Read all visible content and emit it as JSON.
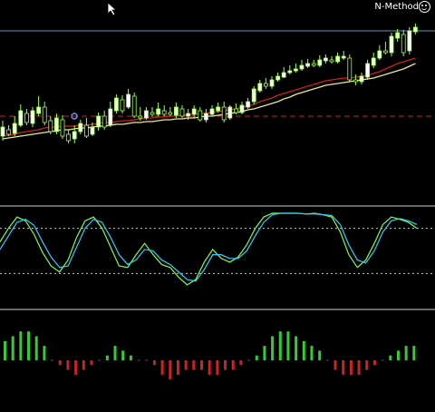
{
  "app": {
    "indicator_label": "N-Method"
  },
  "icons": {
    "ea_status": "smiley-face-icon",
    "pointer": "mouse-cursor-icon"
  },
  "colors": {
    "background": "#000000",
    "candle_bull": "#ffffff",
    "candle_border": "#9bff4c",
    "ma_fast": "#cc1f1f",
    "ma_slow": "#f0e68c",
    "level_line": "#cc2222",
    "price_line": "#5f8fbf",
    "stoch_main": "#7cff4c",
    "stoch_signal": "#33ccff",
    "hist_up": "#33cc33",
    "hist_down": "#cc2222",
    "separator": "#cfcfcf"
  },
  "chart_data": [
    {
      "type": "candlestick",
      "panel": "price",
      "candles": [
        [
          150,
          140,
          155,
          133
        ],
        [
          143,
          148,
          150,
          138
        ],
        [
          147,
          136,
          150,
          128
        ],
        [
          138,
          122,
          140,
          115
        ],
        [
          125,
          135,
          138,
          120
        ],
        [
          136,
          122,
          140,
          118
        ],
        [
          125,
          118,
          128,
          106
        ],
        [
          118,
          135,
          138,
          112
        ],
        [
          133,
          145,
          148,
          128
        ],
        [
          145,
          130,
          148,
          125
        ],
        [
          132,
          150,
          153,
          127
        ],
        [
          148,
          155,
          158,
          143
        ],
        [
          153,
          145,
          158,
          138
        ],
        [
          145,
          136,
          148,
          132
        ],
        [
          138,
          150,
          152,
          130
        ],
        [
          148,
          140,
          150,
          135
        ],
        [
          140,
          128,
          144,
          124
        ],
        [
          128,
          140,
          143,
          122
        ],
        [
          138,
          120,
          140,
          112
        ],
        [
          122,
          108,
          125,
          104
        ],
        [
          110,
          122,
          125,
          105
        ],
        [
          118,
          104,
          120,
          98
        ],
        [
          106,
          128,
          130,
          102
        ],
        [
          128,
          130,
          133,
          118
        ],
        [
          130,
          122,
          132,
          118
        ],
        [
          124,
          126,
          129,
          118
        ],
        [
          126,
          120,
          128,
          113
        ],
        [
          122,
          126,
          128,
          116
        ],
        [
          124,
          125,
          128,
          118
        ],
        [
          127,
          118,
          130,
          113
        ],
        [
          120,
          128,
          130,
          116
        ],
        [
          128,
          125,
          132,
          120
        ],
        [
          126,
          120,
          130,
          116
        ],
        [
          122,
          132,
          134,
          118
        ],
        [
          132,
          125,
          135,
          120
        ],
        [
          126,
          120,
          128,
          116
        ],
        [
          122,
          118,
          124,
          113
        ],
        [
          118,
          132,
          135,
          112
        ],
        [
          130,
          118,
          132,
          116
        ],
        [
          120,
          124,
          126,
          114
        ],
        [
          124,
          116,
          126,
          112
        ],
        [
          118,
          112,
          120,
          108
        ],
        [
          112,
          98,
          115,
          95
        ],
        [
          100,
          92,
          102,
          88
        ],
        [
          92,
          95,
          98,
          86
        ],
        [
          95,
          88,
          98,
          84
        ],
        [
          88,
          84,
          90,
          80
        ],
        [
          85,
          80,
          86,
          74
        ],
        [
          80,
          78,
          82,
          72
        ],
        [
          78,
          76,
          80,
          70
        ],
        [
          76,
          72,
          78,
          66
        ],
        [
          73,
          70,
          75,
          65
        ],
        [
          70,
          72,
          74,
          66
        ],
        [
          72,
          66,
          74,
          61
        ],
        [
          67,
          64,
          70,
          60
        ],
        [
          66,
          68,
          70,
          62
        ],
        [
          68,
          62,
          70,
          58
        ],
        [
          64,
          62,
          66,
          56
        ],
        [
          64,
          88,
          90,
          60
        ],
        [
          88,
          90,
          94,
          82
        ],
        [
          90,
          84,
          93,
          80
        ],
        [
          85,
          70,
          88,
          66
        ],
        [
          72,
          64,
          75,
          58
        ],
        [
          64,
          56,
          66,
          50
        ],
        [
          56,
          58,
          60,
          46
        ],
        [
          58,
          40,
          62,
          36
        ],
        [
          42,
          36,
          46,
          32
        ],
        [
          38,
          58,
          62,
          33
        ],
        [
          56,
          34,
          60,
          30
        ],
        [
          35,
          30,
          38,
          26
        ]
      ],
      "moving_averages": [
        {
          "name": "fast",
          "values": [
            150,
            149,
            148,
            146,
            145,
            144,
            143,
            141,
            140,
            140,
            139,
            139,
            139,
            138,
            138,
            137,
            136,
            135,
            135,
            134,
            133,
            133,
            132,
            131,
            130,
            130,
            129,
            129,
            128,
            128,
            127,
            126,
            126,
            125,
            125,
            124,
            123,
            122,
            121,
            120,
            118,
            117,
            115,
            112,
            110,
            108,
            105,
            103,
            101,
            99,
            97,
            95,
            93,
            91,
            89,
            88,
            87,
            86,
            86,
            85,
            84,
            83,
            81,
            79,
            76,
            73,
            70,
            68,
            66,
            64
          ]
        },
        {
          "name": "slow",
          "values": [
            153,
            152,
            151,
            150,
            149,
            148,
            147,
            146,
            145,
            144,
            143,
            143,
            142,
            141,
            141,
            140,
            139,
            139,
            138,
            137,
            137,
            136,
            135,
            135,
            134,
            134,
            133,
            132,
            132,
            131,
            131,
            130,
            130,
            129,
            128,
            128,
            127,
            126,
            125,
            124,
            123,
            121,
            120,
            118,
            116,
            114,
            112,
            109,
            107,
            104,
            102,
            100,
            98,
            96,
            94,
            93,
            92,
            91,
            90,
            89,
            88,
            87,
            86,
            84,
            82,
            80,
            78,
            76,
            73,
            70
          ]
        }
      ],
      "reference_levels": [
        {
          "kind": "dashed",
          "value": 128
        },
        {
          "kind": "solid",
          "value": 34
        }
      ]
    },
    {
      "type": "line",
      "panel": "stochastic",
      "series": [
        {
          "values": [
            62,
            80,
            95,
            90,
            72,
            48,
            30,
            22,
            38,
            68,
            90,
            95,
            80,
            55,
            30,
            28,
            45,
            60,
            45,
            32,
            28,
            15,
            5,
            12,
            35,
            52,
            40,
            35,
            42,
            58,
            80,
            95,
            100,
            100,
            100,
            100,
            99,
            100,
            98,
            95,
            75,
            45,
            28,
            38,
            60,
            85,
            95,
            92,
            88,
            80
          ]
        },
        {
          "values": [
            52,
            70,
            88,
            92,
            84,
            62,
            42,
            28,
            30,
            55,
            80,
            92,
            88,
            68,
            45,
            32,
            38,
            52,
            50,
            38,
            32,
            22,
            12,
            10,
            25,
            45,
            45,
            40,
            40,
            50,
            70,
            88,
            98,
            100,
            100,
            100,
            99,
            99,
            98,
            97,
            85,
            58,
            38,
            34,
            50,
            75,
            90,
            93,
            90,
            85
          ]
        }
      ]
    },
    {
      "type": "bar",
      "panel": "histogram",
      "values": [
        4,
        5,
        6,
        6,
        5,
        3,
        0,
        -1,
        -2,
        -3,
        -2,
        -1,
        0,
        1,
        3,
        2,
        1,
        0,
        0,
        -1,
        -3,
        -4,
        -3,
        -2,
        -2,
        -2,
        -3,
        -3,
        -2,
        -2,
        -1,
        0,
        1,
        3,
        5,
        6,
        6,
        5,
        4,
        3,
        2,
        0,
        -2,
        -3,
        -3,
        -3,
        -2,
        -1,
        0,
        1,
        2,
        3,
        3
      ]
    }
  ]
}
